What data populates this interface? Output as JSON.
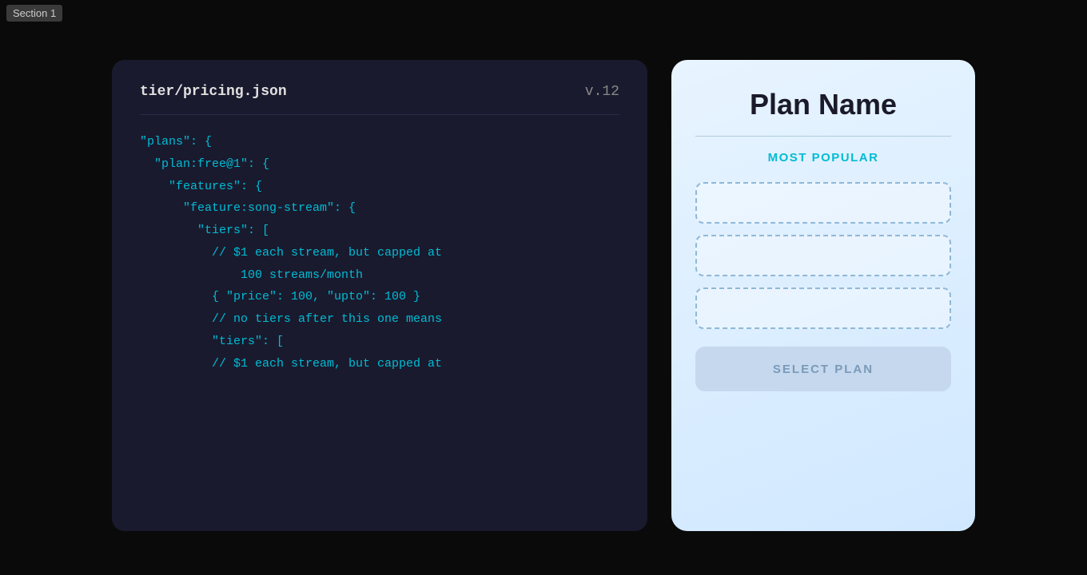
{
  "section_badge": "Section 1",
  "code_card": {
    "filename": "tier/pricing.json",
    "version": "v.12",
    "lines": [
      "\"plans\": {",
      "  \"plan:free@1\": {",
      "    \"features\": {",
      "      \"feature:song-stream\": {",
      "        \"tiers\": [",
      "          // $1 each stream, but capped at",
      "              100 streams/month",
      "          { \"price\": 100, \"upto\": 100 }",
      "          // no tiers after this one means",
      "          \"tiers\": [",
      "          // $1 each stream, but capped at"
    ]
  },
  "plan_card": {
    "title": "Plan Name",
    "most_popular_label": "MOST POPULAR",
    "feature_boxes": [
      {
        "id": "feature-1"
      },
      {
        "id": "feature-2"
      },
      {
        "id": "feature-3"
      }
    ],
    "select_plan_label": "SELECT PLAN"
  }
}
